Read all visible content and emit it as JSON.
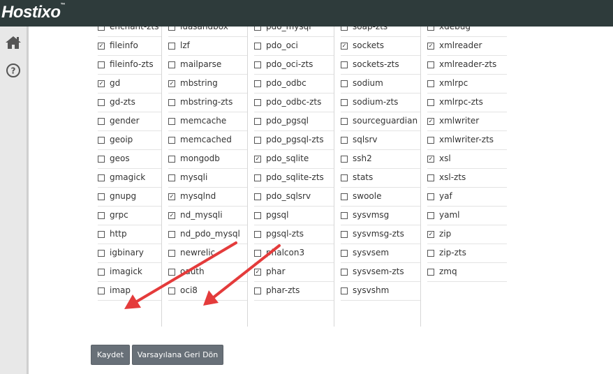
{
  "header": {
    "logo": "Hostixo",
    "logo_mark": "™"
  },
  "sidebar": {
    "icons": [
      "home-icon",
      "help-icon"
    ]
  },
  "accent_color": "#e43b3b",
  "columns": [
    [
      {
        "label": "enchant-zts",
        "checked": false
      },
      {
        "label": "fileinfo",
        "checked": true
      },
      {
        "label": "fileinfo-zts",
        "checked": false
      },
      {
        "label": "gd",
        "checked": true
      },
      {
        "label": "gd-zts",
        "checked": false
      },
      {
        "label": "gender",
        "checked": false
      },
      {
        "label": "geoip",
        "checked": false
      },
      {
        "label": "geos",
        "checked": false
      },
      {
        "label": "gmagick",
        "checked": false
      },
      {
        "label": "gnupg",
        "checked": false
      },
      {
        "label": "grpc",
        "checked": false
      },
      {
        "label": "http",
        "checked": false
      },
      {
        "label": "igbinary",
        "checked": false
      },
      {
        "label": "imagick",
        "checked": false
      },
      {
        "label": "imap",
        "checked": false
      }
    ],
    [
      {
        "label": "luasandbox",
        "checked": false
      },
      {
        "label": "lzf",
        "checked": false
      },
      {
        "label": "mailparse",
        "checked": false
      },
      {
        "label": "mbstring",
        "checked": true
      },
      {
        "label": "mbstring-zts",
        "checked": false
      },
      {
        "label": "memcache",
        "checked": false
      },
      {
        "label": "memcached",
        "checked": false
      },
      {
        "label": "mongodb",
        "checked": false
      },
      {
        "label": "mysqli",
        "checked": false
      },
      {
        "label": "mysqlnd",
        "checked": true
      },
      {
        "label": "nd_mysqli",
        "checked": true
      },
      {
        "label": "nd_pdo_mysql",
        "checked": false
      },
      {
        "label": "newrelic",
        "checked": false
      },
      {
        "label": "oauth",
        "checked": false
      },
      {
        "label": "oci8",
        "checked": false
      }
    ],
    [
      {
        "label": "pdo_mysql",
        "checked": false
      },
      {
        "label": "pdo_oci",
        "checked": false
      },
      {
        "label": "pdo_oci-zts",
        "checked": false
      },
      {
        "label": "pdo_odbc",
        "checked": false
      },
      {
        "label": "pdo_odbc-zts",
        "checked": false
      },
      {
        "label": "pdo_pgsql",
        "checked": false
      },
      {
        "label": "pdo_pgsql-zts",
        "checked": false
      },
      {
        "label": "pdo_sqlite",
        "checked": true
      },
      {
        "label": "pdo_sqlite-zts",
        "checked": false
      },
      {
        "label": "pdo_sqlsrv",
        "checked": false
      },
      {
        "label": "pgsql",
        "checked": false
      },
      {
        "label": "pgsql-zts",
        "checked": false
      },
      {
        "label": "phalcon3",
        "checked": false
      },
      {
        "label": "phar",
        "checked": true
      },
      {
        "label": "phar-zts",
        "checked": false
      }
    ],
    [
      {
        "label": "soap-zts",
        "checked": false
      },
      {
        "label": "sockets",
        "checked": true
      },
      {
        "label": "sockets-zts",
        "checked": false
      },
      {
        "label": "sodium",
        "checked": false
      },
      {
        "label": "sodium-zts",
        "checked": false
      },
      {
        "label": "sourceguardian",
        "checked": false
      },
      {
        "label": "sqlsrv",
        "checked": false
      },
      {
        "label": "ssh2",
        "checked": false
      },
      {
        "label": "stats",
        "checked": false
      },
      {
        "label": "swoole",
        "checked": false
      },
      {
        "label": "sysvmsg",
        "checked": false
      },
      {
        "label": "sysvmsg-zts",
        "checked": false
      },
      {
        "label": "sysvsem",
        "checked": false
      },
      {
        "label": "sysvsem-zts",
        "checked": false
      },
      {
        "label": "sysvshm",
        "checked": false
      }
    ],
    [
      {
        "label": "xdebug",
        "checked": false
      },
      {
        "label": "xmlreader",
        "checked": true
      },
      {
        "label": "xmlreader-zts",
        "checked": false
      },
      {
        "label": "xmlrpc",
        "checked": false
      },
      {
        "label": "xmlrpc-zts",
        "checked": false
      },
      {
        "label": "xmlwriter",
        "checked": true
      },
      {
        "label": "xmlwriter-zts",
        "checked": false
      },
      {
        "label": "xsl",
        "checked": true
      },
      {
        "label": "xsl-zts",
        "checked": false
      },
      {
        "label": "yaf",
        "checked": false
      },
      {
        "label": "yaml",
        "checked": false
      },
      {
        "label": "zip",
        "checked": true
      },
      {
        "label": "zip-zts",
        "checked": false
      },
      {
        "label": "zmq",
        "checked": false
      }
    ]
  ],
  "buttons": {
    "save": "Kaydet",
    "reset": "Varsayılana Geri Dön"
  }
}
